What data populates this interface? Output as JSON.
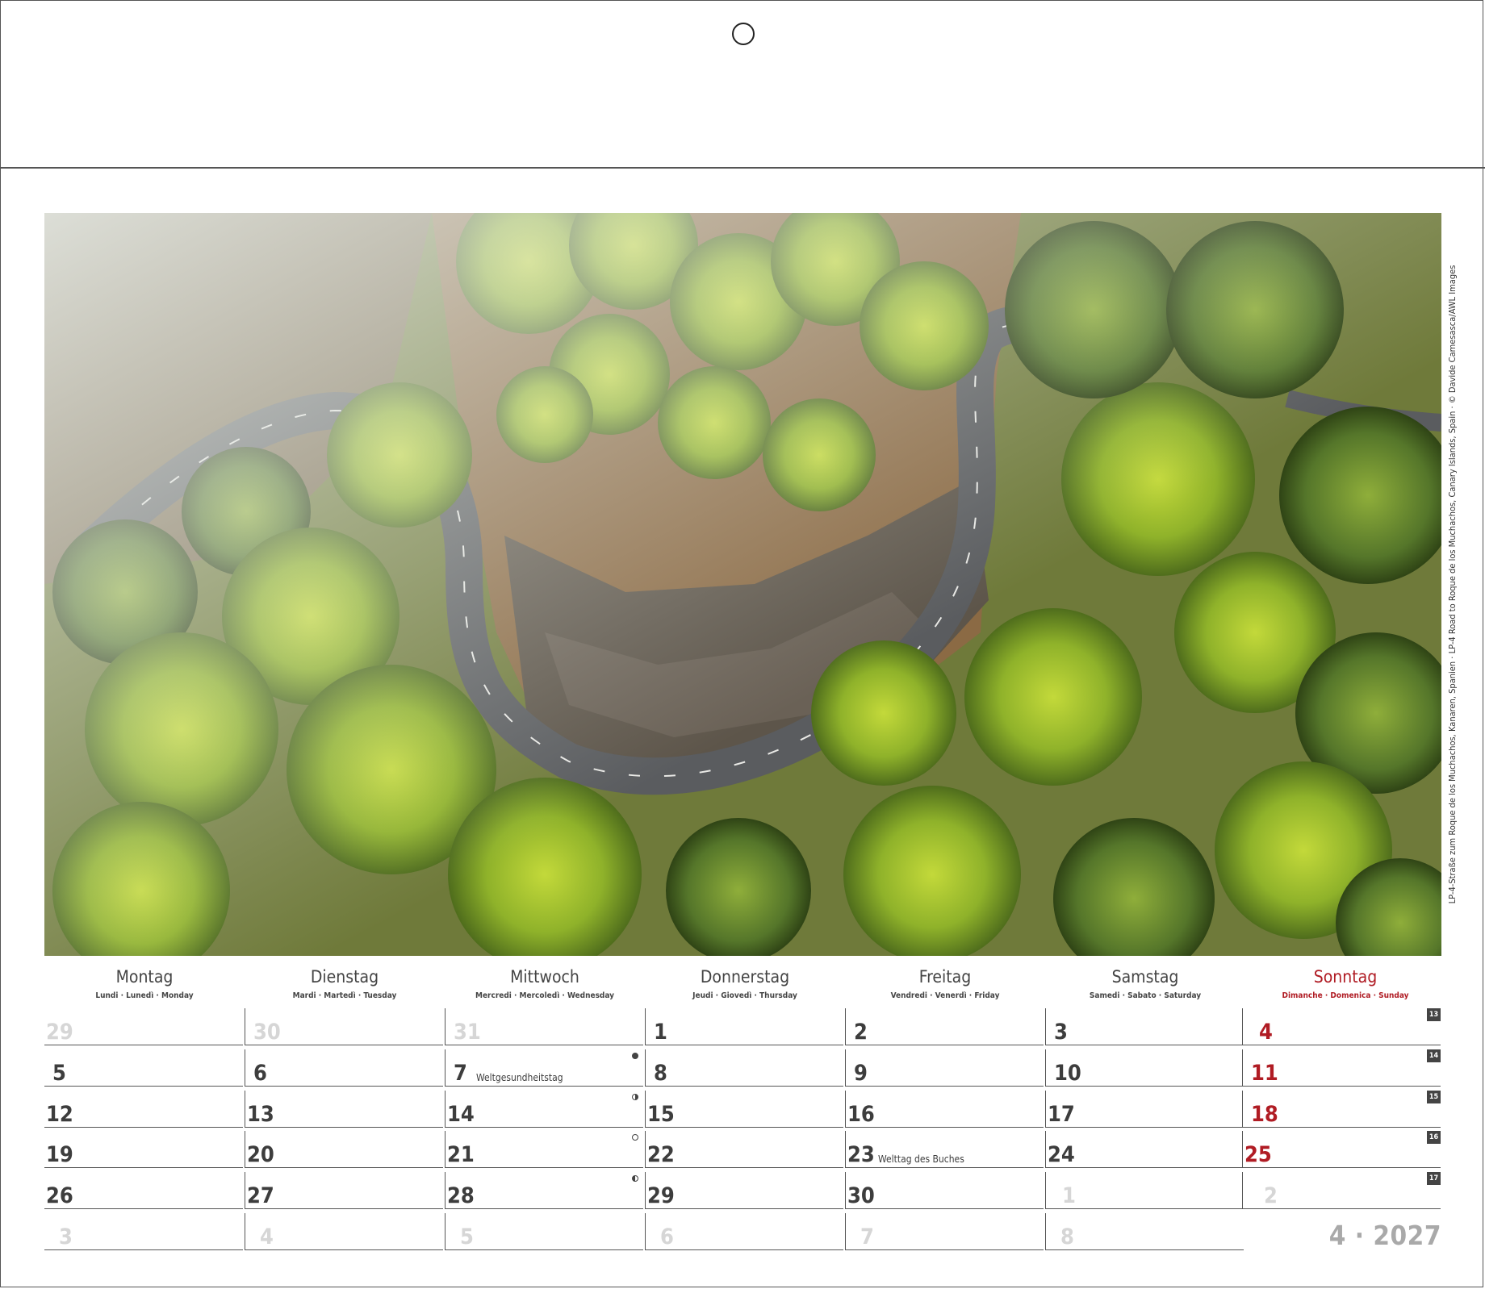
{
  "photo": {
    "subject": "Aerial view of a winding mountain road through a pine forest",
    "colors": {
      "forest_light": "#9dbf2c",
      "forest_dark": "#3e5a1c",
      "ground": "#8b6a44",
      "rock": "#5d554a",
      "road": "#5a5c5f",
      "mist": "#dfe4e2"
    }
  },
  "credit": "LP-4-Straße zum Roque de los Muchachos, Kanaren, Spanien · LP-4 Road to Roque de los Muchachos, Canary Islands, Spain · © Davide Camesasca/AWL Images",
  "weekdays": [
    {
      "name": "Montag",
      "sub": "Lundi · Lunedì · Monday"
    },
    {
      "name": "Dienstag",
      "sub": "Mardi · Martedì · Tuesday"
    },
    {
      "name": "Mittwoch",
      "sub": "Mercredi · Mercoledì · Wednesday"
    },
    {
      "name": "Donnerstag",
      "sub": "Jeudi · Giovedì · Thursday"
    },
    {
      "name": "Freitag",
      "sub": "Vendredi · Venerdì · Friday"
    },
    {
      "name": "Samstag",
      "sub": "Samedi · Sabato · Saturday"
    },
    {
      "name": "Sonntag",
      "sub": "Dimanche · Domenica · Sunday"
    }
  ],
  "weeks": [
    {
      "week_no": "13",
      "days": [
        "29",
        "30",
        "31",
        "1",
        "2",
        "3",
        "4"
      ]
    },
    {
      "week_no": "14",
      "days": [
        "5",
        "6",
        "7",
        "8",
        "9",
        "10",
        "11"
      ]
    },
    {
      "week_no": "15",
      "days": [
        "12",
        "13",
        "14",
        "15",
        "16",
        "17",
        "18"
      ]
    },
    {
      "week_no": "16",
      "days": [
        "19",
        "20",
        "21",
        "22",
        "23",
        "24",
        "25"
      ]
    },
    {
      "week_no": "17",
      "days": [
        "26",
        "27",
        "28",
        "29",
        "30",
        "1",
        "2"
      ]
    },
    {
      "week_no": "",
      "days": [
        "3",
        "4",
        "5",
        "6",
        "7",
        "8",
        ""
      ]
    }
  ],
  "holidays": {
    "weltgesundheitstag": "Weltgesundheitstag",
    "welttag_des_buches": "Welttag des Buches"
  },
  "moon_phases": [
    "new-moon",
    "first-quarter",
    "full-moon",
    "last-quarter"
  ],
  "month_label": "4 · 2027",
  "colors": {
    "sunday": "#b01c24",
    "text": "#3d3d3d",
    "muted": "#d6d6d6",
    "month_label": "#a9a9a9"
  }
}
